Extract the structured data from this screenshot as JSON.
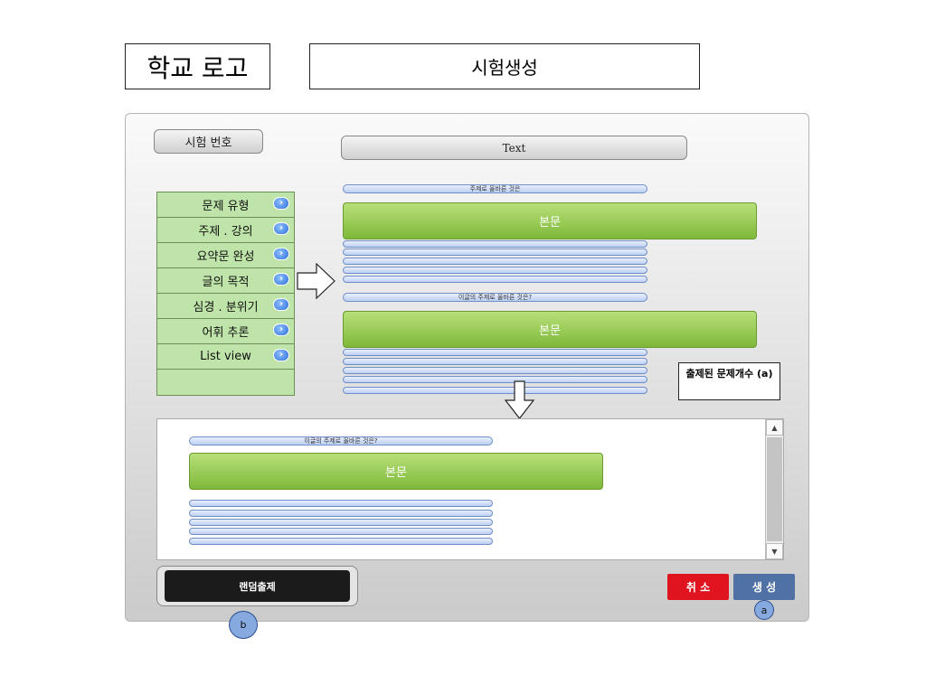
{
  "header": {
    "logo": "학교 로고",
    "title": "시험생성"
  },
  "panel": {
    "exam_number_label": "시험 번호",
    "text_button_label": "Text",
    "menu": [
      {
        "label": "문제 유형"
      },
      {
        "label": "주제 . 강의"
      },
      {
        "label": "요약문 완성"
      },
      {
        "label": "글의 목적"
      },
      {
        "label": "심경 . 분위기"
      },
      {
        "label": "어휘 추론"
      },
      {
        "label": "List view"
      }
    ],
    "question1": {
      "prompt": "주제로 올바른 것은",
      "body": "본문"
    },
    "question2": {
      "prompt": "이글의 주제로 올바른 것은?",
      "body": "본문"
    },
    "count_label": "출제된 문제개수 (a)",
    "preview": {
      "prompt": "이글의 주제로 올바른 것은?",
      "body": "본문"
    },
    "random_button": "랜덤출제",
    "cancel_button": "취 소",
    "create_button": "생 성",
    "marker_a": "a",
    "marker_b": "b"
  }
}
